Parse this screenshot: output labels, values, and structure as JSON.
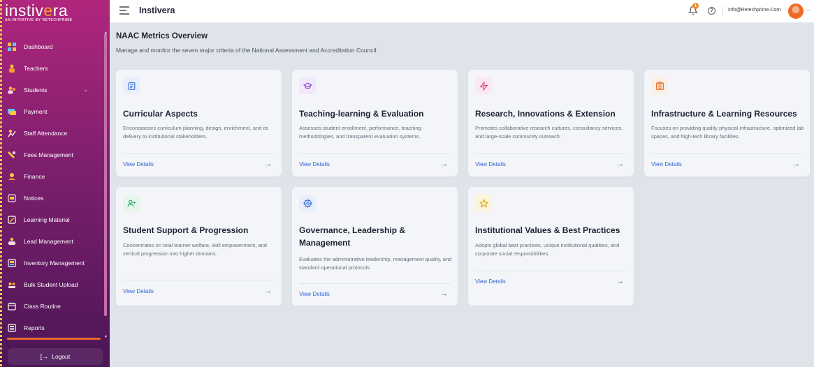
{
  "brand": {
    "name_prefix": "instiv",
    "name_accent": "e",
    "name_suffix": "ra",
    "tagline": "AN INITIATIVE BY RETECHPRIME"
  },
  "sidebar": {
    "items": [
      {
        "label": "Dashboard",
        "icon": "dashboard-icon"
      },
      {
        "label": "Teachers",
        "icon": "teacher-icon"
      },
      {
        "label": "Students",
        "icon": "students-icon",
        "expandable": true
      },
      {
        "label": "Payment",
        "icon": "payment-icon"
      },
      {
        "label": "Staff Attendance",
        "icon": "attendance-icon"
      },
      {
        "label": "Fees Management",
        "icon": "fees-icon"
      },
      {
        "label": "Finance",
        "icon": "finance-icon"
      },
      {
        "label": "Notices",
        "icon": "notices-icon"
      },
      {
        "label": "Learning Material",
        "icon": "learning-material-icon"
      },
      {
        "label": "Lead Management",
        "icon": "lead-icon"
      },
      {
        "label": "Inventory Management",
        "icon": "inventory-icon"
      },
      {
        "label": "Bulk Student Upload",
        "icon": "upload-icon"
      },
      {
        "label": "Class Routine",
        "icon": "calendar-icon"
      },
      {
        "label": "Reports",
        "icon": "reports-icon"
      }
    ],
    "logout_label": "Logout"
  },
  "header": {
    "title": "Instivera",
    "notification_count": "1",
    "help": "?",
    "email": "Info@Retechprime.Com"
  },
  "main": {
    "title": "NAAC Metrics Overview",
    "subtitle": "Manage and monitor the seven major criteria of the National Assessment and Accreditation Council.",
    "cards": [
      {
        "title": "Curricular Aspects",
        "desc": "Encompasses curriculum planning, design, enrichment, and its delivery to institutional stakeholders.",
        "link": "View Details",
        "arrow": "→",
        "icon": "document-icon",
        "icon_bg": "#e7eefc",
        "icon_color": "#2f67d9"
      },
      {
        "title": "Teaching-learning & Evaluation",
        "desc": "Assesses student enrollment, performance, teaching methodologies, and transparent evaluation systems.",
        "link": "View Details",
        "arrow": "→",
        "icon": "graduation-cap-icon",
        "icon_bg": "#f1e8fb",
        "icon_color": "#8b3fd6"
      },
      {
        "title": "Research, Innovations & Extension",
        "desc": "Promotes collaborative research cultures, consultancy services, and large-scale community outreach.",
        "link": "View Details",
        "arrow": "→",
        "icon": "zap-icon",
        "icon_bg": "#fce8f0",
        "icon_color": "#e0356f"
      },
      {
        "title": "Infrastructure & Learning Resources",
        "desc": "Focuses on providing quality physical infrastructure, optimized lab spaces, and high-tech library facilities.",
        "link": "View Details",
        "arrow": "→",
        "icon": "building-icon",
        "icon_bg": "#fdeee3",
        "icon_color": "#e06a1a"
      },
      {
        "title": "Student Support & Progression",
        "desc": "Concentrates on total learner welfare, skill empowerment, and vertical progression into higher domains.",
        "link": "View Details",
        "arrow": "→",
        "icon": "user-plus-icon",
        "icon_bg": "#e6f6ec",
        "icon_color": "#22a05a"
      },
      {
        "title": "Governance, Leadership & Management",
        "desc": "Evaluates the administrative leadership, management quality, and standard operational protocols.",
        "link": "View Details",
        "arrow": "→",
        "icon": "gear-icon",
        "icon_bg": "#e7eefc",
        "icon_color": "#2f67d9"
      },
      {
        "title": "Institutional Values & Best Practices",
        "desc": "Adopts global best practices, unique institutional qualities, and corporate social responsibilities.",
        "link": "View Details",
        "arrow": "→",
        "icon": "star-icon",
        "icon_bg": "#fdf5d9",
        "icon_color": "#d6a200"
      }
    ]
  }
}
